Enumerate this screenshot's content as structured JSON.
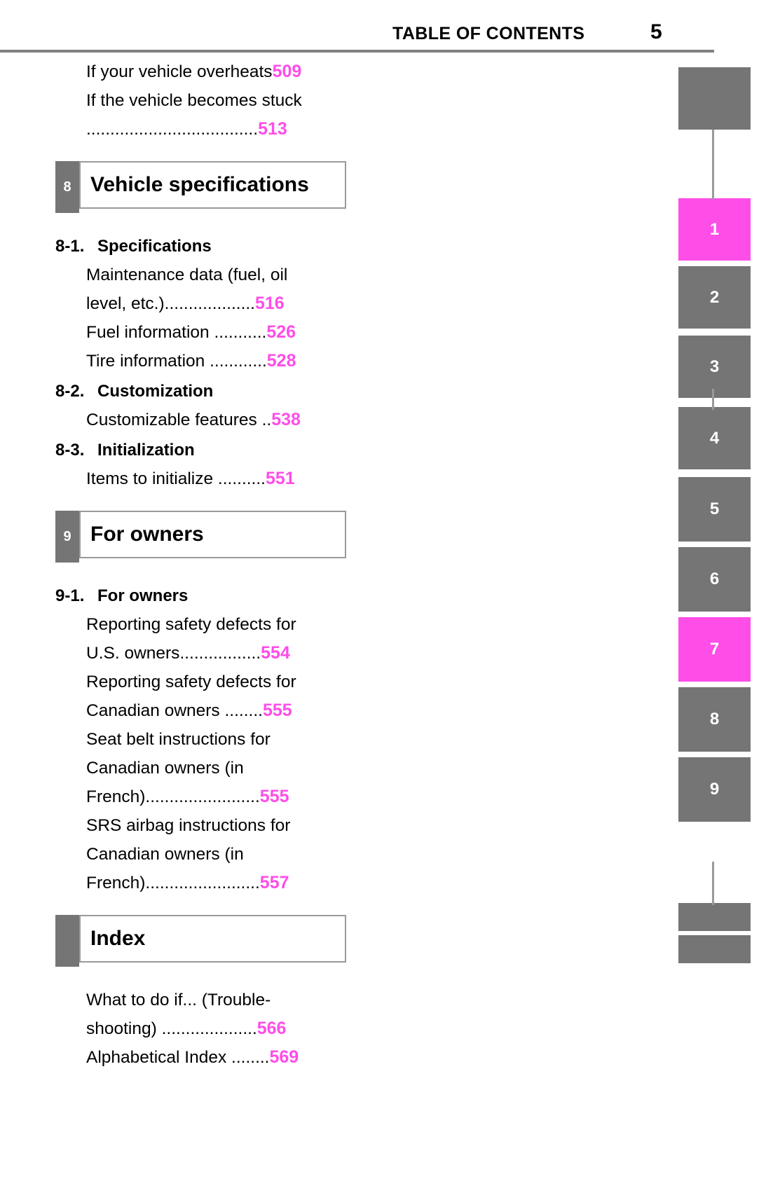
{
  "header": {
    "title": "TABLE OF CONTENTS",
    "page_number": "5"
  },
  "toc": {
    "top_entries": [
      {
        "title": "If your vehicle overheats",
        "leader": "",
        "page": "509"
      },
      {
        "title": "If the vehicle becomes stuck",
        "leader": "",
        "page": ""
      },
      {
        "title": "",
        "leader": "....................................",
        "page": "513"
      }
    ],
    "chapters": [
      {
        "number": "8",
        "title": "Vehicle specifications",
        "sections": [
          {
            "number": "8-1.",
            "label": "Specifications",
            "entries": [
              {
                "title": "Maintenance data (fuel, oil",
                "leader": "",
                "page": ""
              },
              {
                "title": "level, etc.)",
                "leader": "...................",
                "page": "516"
              },
              {
                "title": "Fuel information ",
                "leader": "...........",
                "page": "526"
              },
              {
                "title": "Tire information ",
                "leader": "............",
                "page": "528"
              }
            ]
          },
          {
            "number": "8-2.",
            "label": "Customization",
            "entries": [
              {
                "title": "Customizable features ",
                "leader": "..",
                "page": "538"
              }
            ]
          },
          {
            "number": "8-3.",
            "label": "Initialization",
            "entries": [
              {
                "title": "Items to initialize ",
                "leader": "..........",
                "page": "551"
              }
            ]
          }
        ]
      },
      {
        "number": "9",
        "title": "For owners",
        "sections": [
          {
            "number": "9-1.",
            "label": "For owners",
            "entries": [
              {
                "title": "Reporting safety defects for",
                "leader": "",
                "page": ""
              },
              {
                "title": "U.S. owners",
                "leader": ".................",
                "page": "554"
              },
              {
                "title": "Reporting safety defects for",
                "leader": "",
                "page": ""
              },
              {
                "title": "Canadian owners ",
                "leader": "........",
                "page": "555"
              },
              {
                "title": "Seat belt instructions for",
                "leader": "",
                "page": ""
              },
              {
                "title": "Canadian owners (in",
                "leader": "",
                "page": ""
              },
              {
                "title": "French)",
                "leader": "........................",
                "page": "555"
              },
              {
                "title": "SRS airbag instructions for",
                "leader": "",
                "page": ""
              },
              {
                "title": "Canadian owners (in",
                "leader": "",
                "page": ""
              },
              {
                "title": "French)",
                "leader": "........................",
                "page": "557"
              }
            ]
          }
        ]
      },
      {
        "number": "",
        "title": "Index",
        "sections": [
          {
            "number": "",
            "label": "",
            "entries": [
              {
                "title": "What to do if... (Trouble-",
                "leader": "",
                "page": ""
              },
              {
                "title": "shooting) ",
                "leader": "....................",
                "page": "566"
              },
              {
                "title": "Alphabetical Index ",
                "leader": "........",
                "page": "569"
              }
            ]
          }
        ]
      }
    ]
  },
  "side_tabs": [
    {
      "label": "",
      "active": false
    },
    {
      "label": "1",
      "active": true
    },
    {
      "label": "2",
      "active": false
    },
    {
      "label": "3",
      "active": false
    },
    {
      "label": "4",
      "active": false
    },
    {
      "label": "5",
      "active": false
    },
    {
      "label": "6",
      "active": false
    },
    {
      "label": "7",
      "active": true
    },
    {
      "label": "8",
      "active": false
    },
    {
      "label": "9",
      "active": false
    },
    {
      "label": "",
      "active": false
    },
    {
      "label": "",
      "active": false
    }
  ],
  "colors": {
    "accent_magenta": "#ff4de8",
    "tab_gray": "#757575",
    "rule_gray": "#808080"
  }
}
